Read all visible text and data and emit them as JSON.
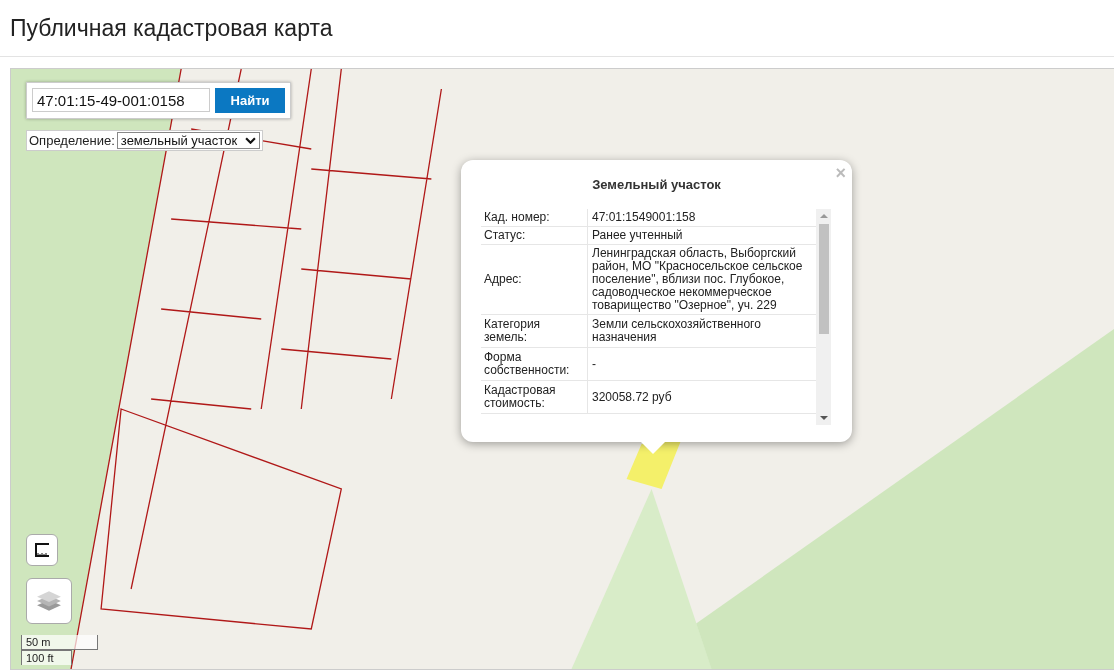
{
  "page_title": "Публичная кадастровая карта",
  "search": {
    "value": "47:01:15-49-001:0158",
    "button": "Найти"
  },
  "definition": {
    "label": "Определение:",
    "value": "земельный участок"
  },
  "popup": {
    "title": "Земельный участок",
    "close": "×",
    "rows": [
      {
        "label": "Кад. номер:",
        "value": "47:01:1549001:158"
      },
      {
        "label": "Статус:",
        "value": "Ранее учтенный"
      },
      {
        "label": "Адрес:",
        "value": "Ленинградская область, Выборгский район, МО \"Красносельское сельское поселение\", вблизи пос. Глубокое, садоводческое некоммерческое товарищество \"Озерное\", уч. 229"
      },
      {
        "label": "Категория земель:",
        "value": "Земли сельскохозяйственного назначения"
      },
      {
        "label": "Форма собственности:",
        "value": "-"
      },
      {
        "label": "Кадастровая стоимость:",
        "value": "320058.72 руб"
      }
    ]
  },
  "scale": {
    "metric": "50 m",
    "imperial": "100 ft"
  }
}
